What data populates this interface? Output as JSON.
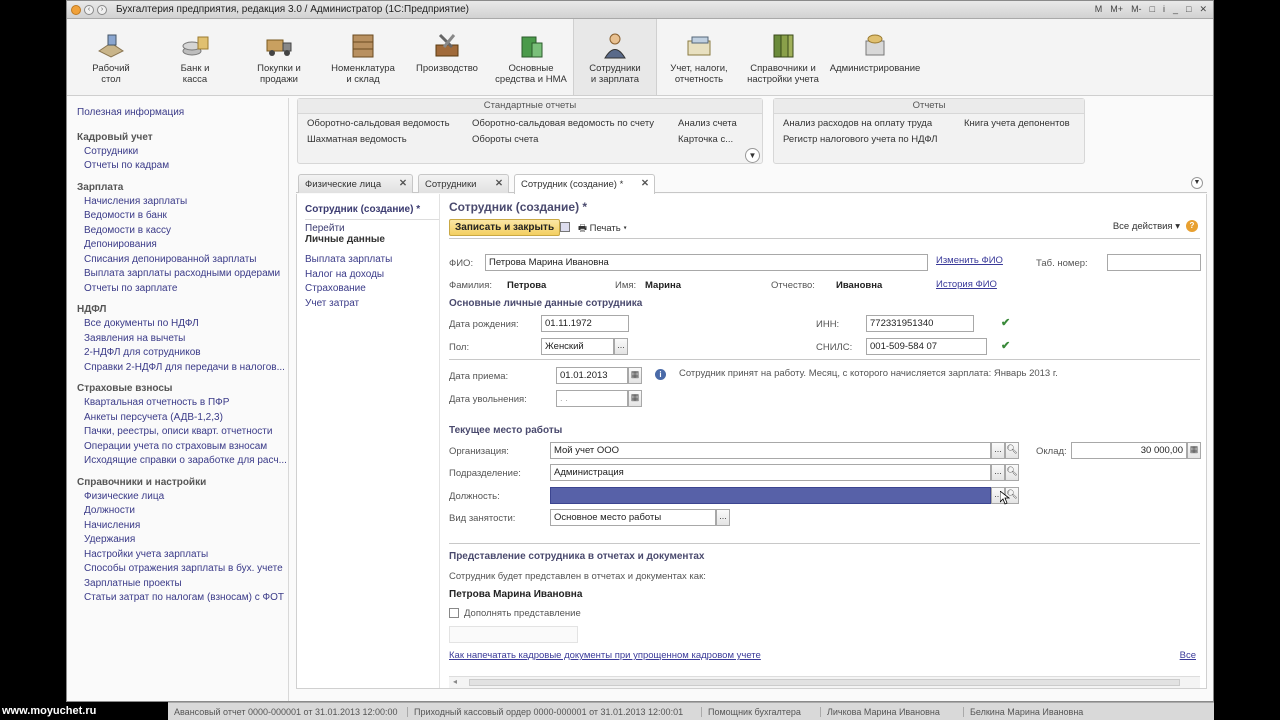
{
  "window": {
    "title": "Бухгалтерия предприятия, редакция 3.0 / Администратор  (1С:Предприятие)",
    "tools": [
      "M",
      "M+",
      "M-",
      "□",
      "i"
    ]
  },
  "sections": [
    {
      "line1": "Рабочий",
      "line2": "стол",
      "icon": "desk-icon"
    },
    {
      "line1": "Банк и",
      "line2": "касса",
      "icon": "bank-icon"
    },
    {
      "line1": "Покупки и",
      "line2": "продажи",
      "icon": "truck-icon"
    },
    {
      "line1": "Номенклатура",
      "line2": "и склад",
      "icon": "warehouse-icon"
    },
    {
      "line1": "Производство",
      "line2": "",
      "icon": "tools-icon"
    },
    {
      "line1": "Основные",
      "line2": "средства и НМА",
      "icon": "assets-icon"
    },
    {
      "line1": "Сотрудники",
      "line2": "и зарплата",
      "icon": "employee-icon"
    },
    {
      "line1": "Учет, налоги,",
      "line2": "отчетность",
      "icon": "tax-icon"
    },
    {
      "line1": "Справочники и",
      "line2": "настройки учета",
      "icon": "books-icon"
    },
    {
      "line1": "Администрирование",
      "line2": "",
      "icon": "admin-icon"
    }
  ],
  "sidebar": {
    "info": "Полезная информация",
    "groups": [
      {
        "title": "Кадровый учет",
        "items": [
          "Сотрудники",
          "Отчеты по кадрам"
        ]
      },
      {
        "title": "Зарплата",
        "items": [
          "Начисления зарплаты",
          "Ведомости в банк",
          "Ведомости в кассу",
          "Депонирования",
          "Списания депонированной зарплаты",
          "Выплата зарплаты расходными ордерами",
          "Отчеты по зарплате"
        ]
      },
      {
        "title": "НДФЛ",
        "items": [
          "Все документы по НДФЛ",
          "Заявления на вычеты",
          "2-НДФЛ для сотрудников",
          "Справки 2-НДФЛ для передачи в налогов..."
        ]
      },
      {
        "title": "Страховые взносы",
        "items": [
          "Квартальная отчетность в ПФР",
          "Анкеты персучета (АДВ-1,2,3)",
          "Пачки, реестры, описи кварт. отчетности",
          "Операции учета по страховым взносам",
          "Исходящие справки о заработке для расч..."
        ]
      },
      {
        "title": "Справочники и настройки",
        "items": [
          "Физические лица",
          "Должности",
          "Начисления",
          "Удержания",
          "Настройки учета зарплаты",
          "Способы отражения зарплаты в бух. учете",
          "Зарплатные проекты",
          "Статьи затрат по налогам (взносам) с ФОТ"
        ]
      }
    ]
  },
  "reports": {
    "standard": {
      "title": "Стандартные отчеты",
      "links": [
        "Оборотно-сальдовая ведомость",
        "Оборотно-сальдовая ведомость по счету",
        "Анализ счета",
        "Шахматная ведомость",
        "Обороты счета",
        "Карточка с..."
      ]
    },
    "other": {
      "title": "Отчеты",
      "links": [
        "Анализ расходов на оплату труда",
        "Книга учета депонентов",
        "Регистр налогового учета по НДФЛ"
      ]
    }
  },
  "tabs": [
    {
      "label": "Физические лица"
    },
    {
      "label": "Сотрудники"
    },
    {
      "label": "Сотрудник (создание) *"
    }
  ],
  "nav": {
    "title": "Сотрудник (создание) *",
    "goto": "Перейти",
    "current": "Личные данные",
    "links": [
      "Выплата зарплаты",
      "Налог на доходы",
      "Страхование",
      "Учет затрат"
    ]
  },
  "form": {
    "title": "Сотрудник (создание) *",
    "save_close": "Записать и закрыть",
    "print": "Печать",
    "all_actions": "Все действия",
    "help": "?",
    "fio_label": "ФИО:",
    "fio_value": "Петрова Марина Ивановна",
    "change_fio": "Изменить ФИО",
    "tab_num_label": "Таб. номер:",
    "tab_num_value": "",
    "surname_label": "Фамилия:",
    "surname_value": "Петрова",
    "name_label": "Имя:",
    "name_value": "Марина",
    "patronymic_label": "Отчество:",
    "patronymic_value": "Ивановна",
    "fio_history": "История ФИО",
    "personal_header": "Основные личные данные сотрудника",
    "birth_label": "Дата рождения:",
    "birth_value": "01.11.1972",
    "inn_label": "ИНН:",
    "inn_value": "772331951340",
    "gender_label": "Пол:",
    "gender_value": "Женский",
    "snils_label": "СНИЛС:",
    "snils_value": "001-509-584 07",
    "hire_label": "Дата приема:",
    "hire_value": "01.01.2013",
    "hire_note": "Сотрудник принят на работу. Месяц, с которого начисляется зарплата: Январь 2013 г.",
    "fire_label": "Дата увольнения:",
    "fire_value": " .  .",
    "workplace_header": "Текущее место работы",
    "org_label": "Организация:",
    "org_value": "Мой учет ООО",
    "salary_label": "Оклад:",
    "salary_value": "30 000,00",
    "dept_label": "Подразделение:",
    "dept_value": "Администрация",
    "position_label": "Должность:",
    "position_value": "",
    "employment_label": "Вид занятости:",
    "employment_value": "Основное место работы",
    "repr_header": "Представление сотрудника в отчетах и документах",
    "repr_note": "Сотрудник будет представлен в отчетах и документах как:",
    "repr_name": "Петрова Марина Ивановна",
    "repr_extend": "Дополнять представление",
    "print_docs_link": "Как напечатать кадровые документы при упрощенном кадровом учете",
    "all_link": "Все"
  },
  "statusbar": [
    "Авансовый отчет 0000-000001 от 31.01.2013 12:00:00",
    "Приходный кассовый ордер 0000-000001 от 31.01.2013 12:00:01",
    "Помощник бухгалтера",
    "Личкова Марина Ивановна",
    "Белкина Марина Ивановна"
  ],
  "watermark": "www.moyuchet.ru"
}
